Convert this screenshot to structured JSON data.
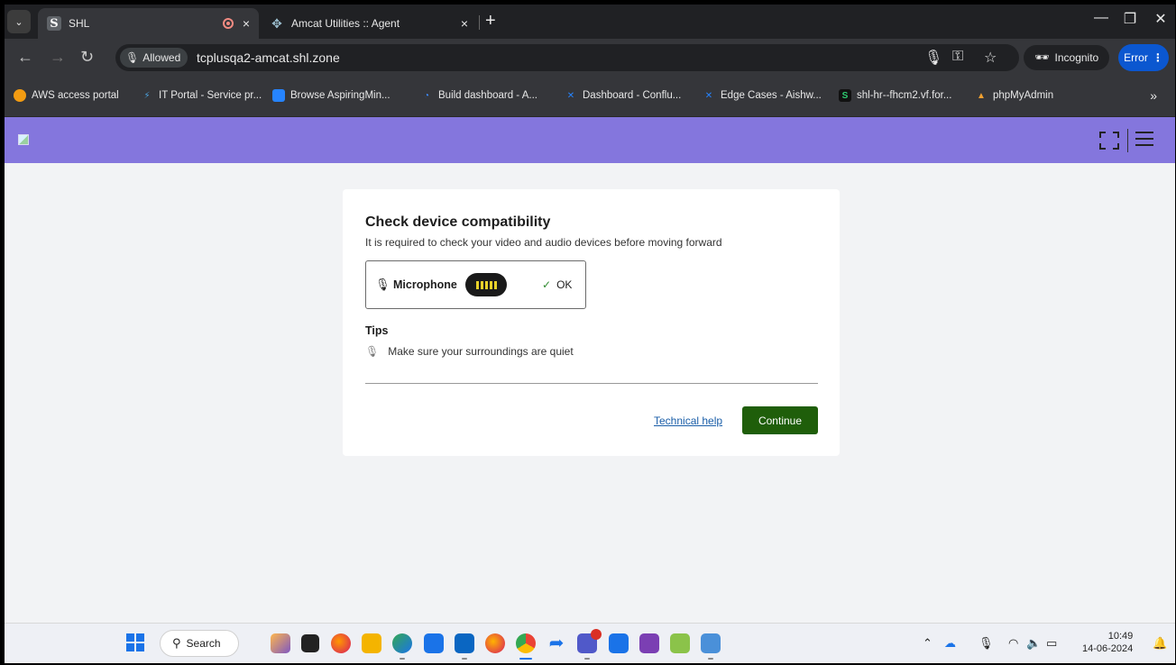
{
  "browser": {
    "tabs": [
      {
        "title": "SHL",
        "favicon": "S",
        "active": true
      },
      {
        "title": "Amcat Utilities :: Agent",
        "favicon": "settings-icon",
        "active": false
      }
    ],
    "close_glyph": "×",
    "new_tab_glyph": "+",
    "window_controls": {
      "minimize": "—",
      "restore": "❐",
      "close": "✕"
    }
  },
  "toolbar": {
    "permission_label": "Allowed",
    "url": "tcplusqa2-amcat.shl.zone",
    "incognito_label": "Incognito",
    "error_label": "Error",
    "error_menu": "⋮"
  },
  "bookmarks": [
    {
      "label": "AWS access portal",
      "icon": "aws-icon",
      "color": "#f39c12"
    },
    {
      "label": "IT Portal - Service pr...",
      "icon": "servicedesk-icon",
      "color": "#4aa3df"
    },
    {
      "label": "Browse AspiringMin...",
      "icon": "jira-icon",
      "color": "#2684ff"
    },
    {
      "label": "Build dashboard - A...",
      "icon": "bamboo-icon",
      "color": "#3d8bfd"
    },
    {
      "label": "Dashboard - Conflu...",
      "icon": "confluence-icon",
      "color": "#2684ff"
    },
    {
      "label": "Edge Cases - Aishw...",
      "icon": "confluence-icon",
      "color": "#2684ff"
    },
    {
      "label": "shl-hr--fhcm2.vf.for...",
      "icon": "s-icon",
      "color": "#1a8a3a"
    },
    {
      "label": "phpMyAdmin",
      "icon": "phpmyadmin-icon",
      "color": "#f0a030"
    }
  ],
  "bookmarks_more": "»",
  "page": {
    "header_color": "#8476dd",
    "card": {
      "title": "Check device compatibility",
      "subtitle": "It is required to check your video and audio devices before moving forward",
      "device_label": "Microphone",
      "mic_level": 1.0,
      "status_check": "✓",
      "status_text": "OK",
      "tips_heading": "Tips",
      "tip_text": "Make sure your surroundings are quiet",
      "help_link": "Technical help",
      "continue_label": "Continue",
      "continue_color": "#1f5e0a"
    }
  },
  "taskbar": {
    "search_label": "Search",
    "time": "10:49",
    "date": "14-06-2024"
  }
}
